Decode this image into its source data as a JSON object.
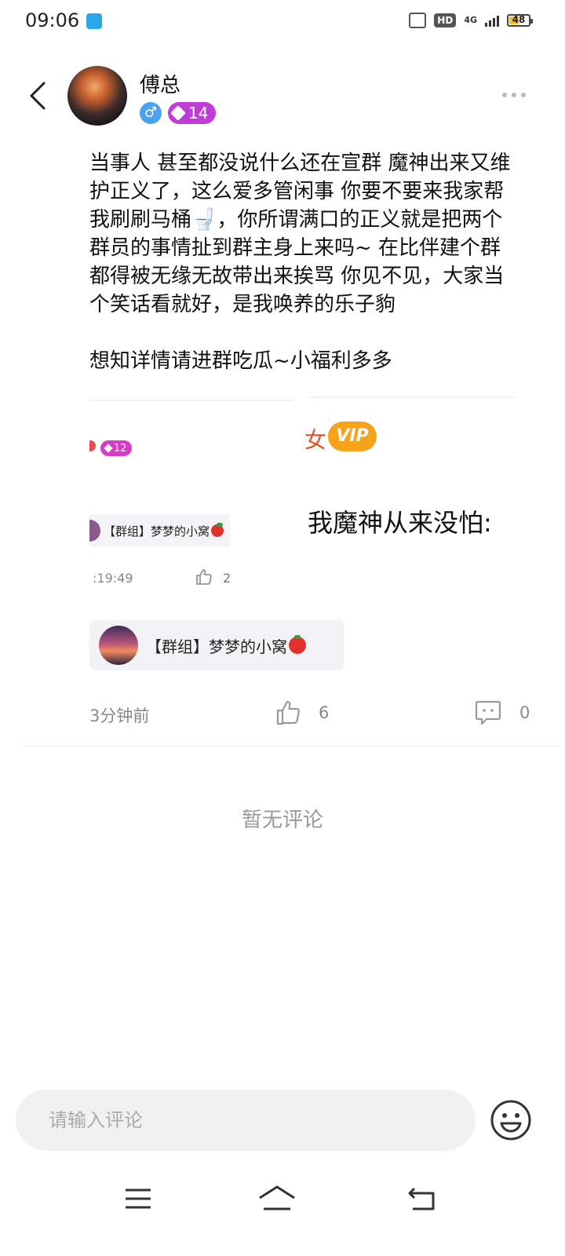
{
  "status_bar": {
    "time": "09:06",
    "network": "4G",
    "hd_label": "HD",
    "battery": "48",
    "battery_level": 0.48
  },
  "header": {
    "username": "傅总",
    "gender_symbol": "♂",
    "level": "14"
  },
  "post": {
    "paragraph1": "当事人 甚至都没说什么还在宣群 魔神出来又维护正义了，这么爱多管闲事 你要不要来我家帮我刷刷马桶🚽，你所谓满口的正义就是把两个群员的事情扯到群主身上来吗~ 在比伴建个群都得被无缘无故带出来挨骂 你见不见，大家当个笑话看就好，是我唤养的乐子豿",
    "paragraph2": "想知详情请进群吃瓜~小福利多多"
  },
  "embedded_screenshot": {
    "mini_level": "12",
    "partial_char": "女",
    "vip_label": "VIP",
    "big_text": "我魔神从来没怕:",
    "group_tag": "【群组】梦梦的小窝",
    "time": ":19:49",
    "like_count": "2"
  },
  "group_card": {
    "name": "【群组】梦梦的小窝"
  },
  "meta": {
    "time_ago": "3分钟前",
    "like_count": "6",
    "comment_count": "0"
  },
  "comments": {
    "empty_text": "暂无评论"
  },
  "comment_input": {
    "placeholder": "请输入评论"
  },
  "colors": {
    "level_badge": "#bf3cd8",
    "gender_badge": "#4aa3f0",
    "vip": "#f7a21b"
  }
}
